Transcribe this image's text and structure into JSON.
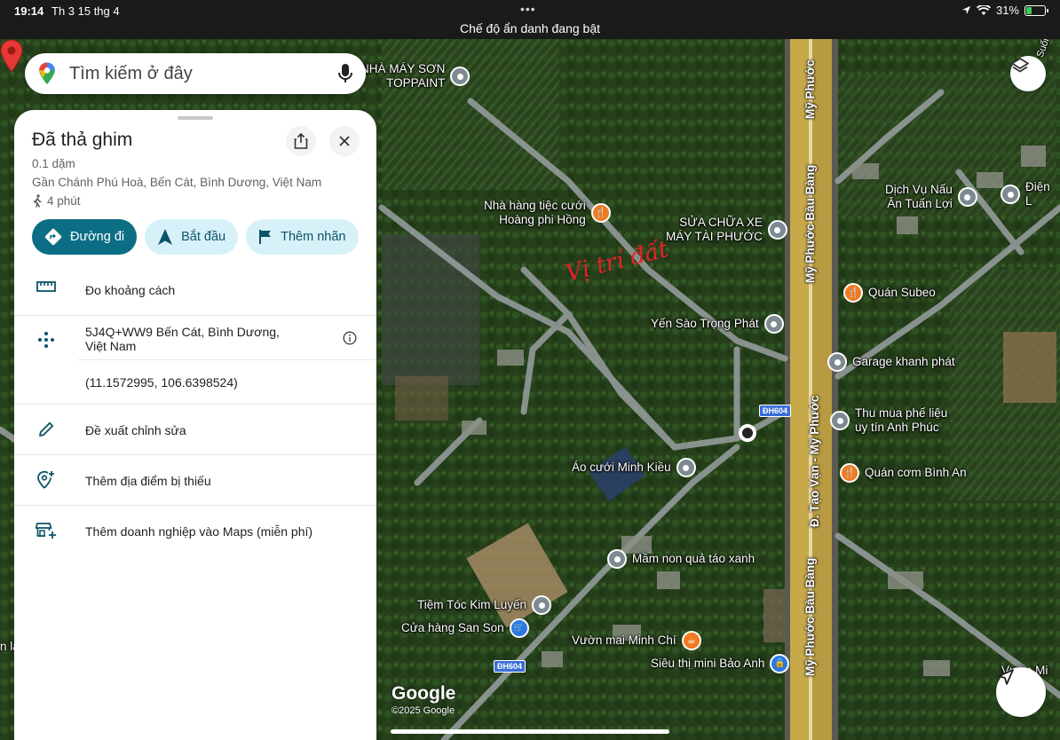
{
  "status_bar": {
    "time": "19:14",
    "date": "Th 3 15 thg 4",
    "incognito_notice": "Chế độ ẩn danh đang bật",
    "battery": "31%",
    "battery_level": 0.31
  },
  "search": {
    "placeholder": "Tìm kiếm ở đây"
  },
  "panel": {
    "title": "Đã thả ghim",
    "distance": "0.1 dặm",
    "address": "Gần Chánh Phú Hoà, Bến Cát, Bình Dương, Việt Nam",
    "walk_time": "4 phút",
    "actions": {
      "directions": "Đường đi",
      "start": "Bắt đầu",
      "add_label": "Thêm nhãn"
    },
    "rows": {
      "measure": "Đo khoảng cách",
      "plus_code_line1": "5J4Q+WW9 Bến Cát, Bình Dương,",
      "plus_code_line2": "Việt Nam",
      "coordinates": "(11.1572995, 106.6398524)",
      "suggest_edit": "Đề xuất chỉnh sửa",
      "add_missing_place": "Thêm địa điểm bị thiếu",
      "add_business": "Thêm doanh nghiệp vào Maps (miễn phí)"
    }
  },
  "map": {
    "handwritten_note": "Vị trí đất",
    "pois": {
      "toppaint_1": "NHÀ MÁY SƠN",
      "toppaint_2": "TOPPAINT",
      "wedding_1": "Nhà hàng tiệc cưới",
      "wedding_2": "Hoàng phi Hồng",
      "repair_1": "SỬA CHỮA XE",
      "repair_2": "MÁY TÀI PHƯỚC",
      "noodle_1": "Dịch Vụ Nấu",
      "noodle_2": "Ăn Tuấn Lợi",
      "electric": "Điện L",
      "subeo": "Quán Subeo",
      "yensao": "Yến Sào Trọng Phát",
      "garage": "Garage khanh phát",
      "scrap_1": "Thu mua phế liệu",
      "scrap_2": "uy tín Anh Phúc",
      "aocuoi": "Áo cưới Minh Kiều",
      "comquan": "Quán cơm Bình An",
      "mamnon": "Mầm non quả táo xanh",
      "tiemtoc": "Tiệm Tóc Kim Luyến",
      "cuahang": "Cửa hàng San Son",
      "vuonmai": "Vườn mai Minh Chí",
      "sieuthi": "Siêu thị mini Bảo Anh",
      "vuonmi": "Vườn Mi",
      "left_edge": "n la"
    },
    "roads": {
      "main_1": "Mỹ Phước Bàu Bàng",
      "main_top": "Mỹ Phước",
      "main_mid": "Đ. Tạo Vạn - Mỹ Phước",
      "main_bottom": "Mỹ Phước Bàu Bàng",
      "shield_1": "ĐH604",
      "shield_2": "ĐH604",
      "corner": "Suối"
    },
    "google": "Google",
    "copyright": "©2025 Google"
  },
  "colors": {
    "primary": "#0b6e84",
    "secondary_chip": "#d7f1f9",
    "pin_red": "#e53935",
    "poi_orange": "#f07b22",
    "poi_grey": "#7d8a92"
  }
}
